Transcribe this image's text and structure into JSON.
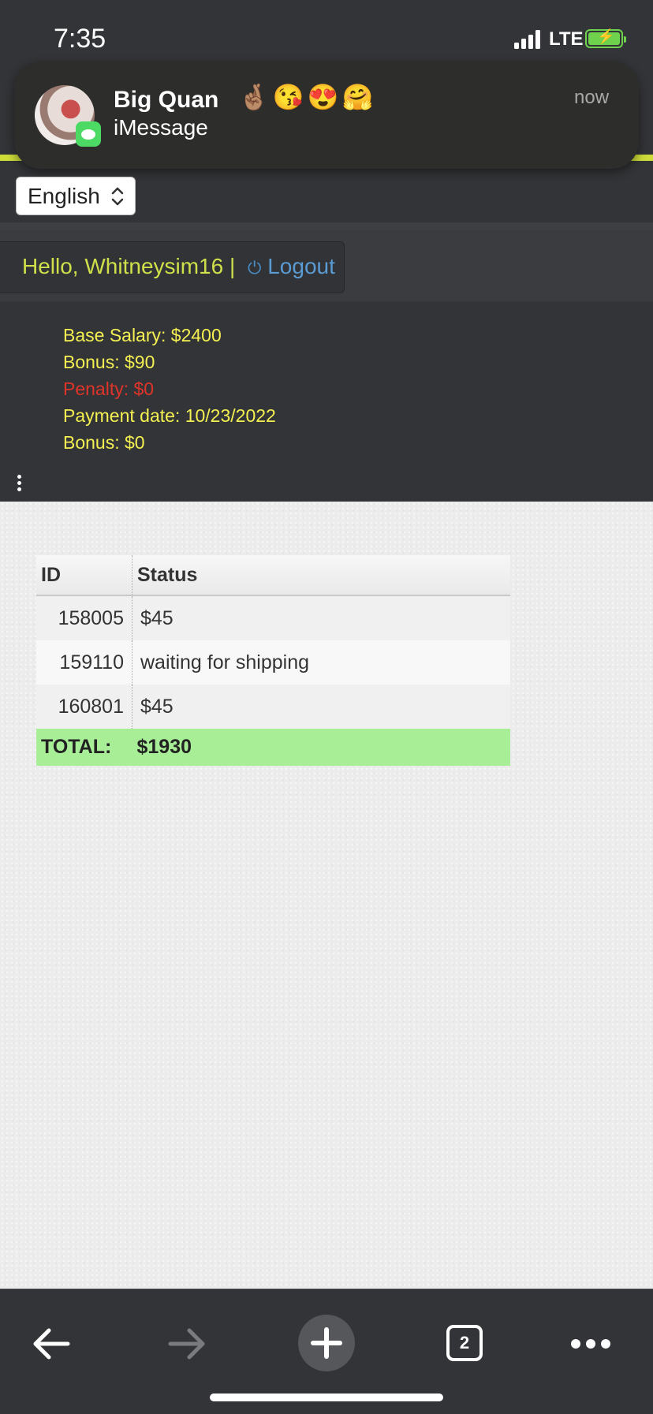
{
  "status_bar": {
    "time": "7:35",
    "network": "LTE"
  },
  "notification": {
    "sender": "Big Quan",
    "emojis": "🤞🏽😘😍🤗",
    "app": "iMessage",
    "time": "now"
  },
  "language": {
    "selected": "English"
  },
  "greeting": {
    "hello": "Hello, Whitneysim16 |",
    "logout": "Logout"
  },
  "salary": {
    "base": "Base Salary: $2400",
    "bonus1": "Bonus: $90",
    "penalty": "Penalty: $0",
    "payment_date": "Payment date: 10/23/2022",
    "bonus2": "Bonus: $0"
  },
  "table": {
    "headers": {
      "id": "ID",
      "status": "Status"
    },
    "rows": [
      {
        "id": "158005",
        "status": "$45"
      },
      {
        "id": "159110",
        "status": "waiting for shipping"
      },
      {
        "id": "160801",
        "status": "$45"
      }
    ],
    "total_label": "TOTAL:",
    "total_value": "$1930"
  },
  "toolbar": {
    "tab_count": "2"
  },
  "colors": {
    "header_bg": "#333437",
    "accent": "#cddc39",
    "greeting_text": "#cfe04a",
    "salary_text": "#f4f052",
    "penalty_text": "#e0342a",
    "total_row": "#a8ee96"
  }
}
